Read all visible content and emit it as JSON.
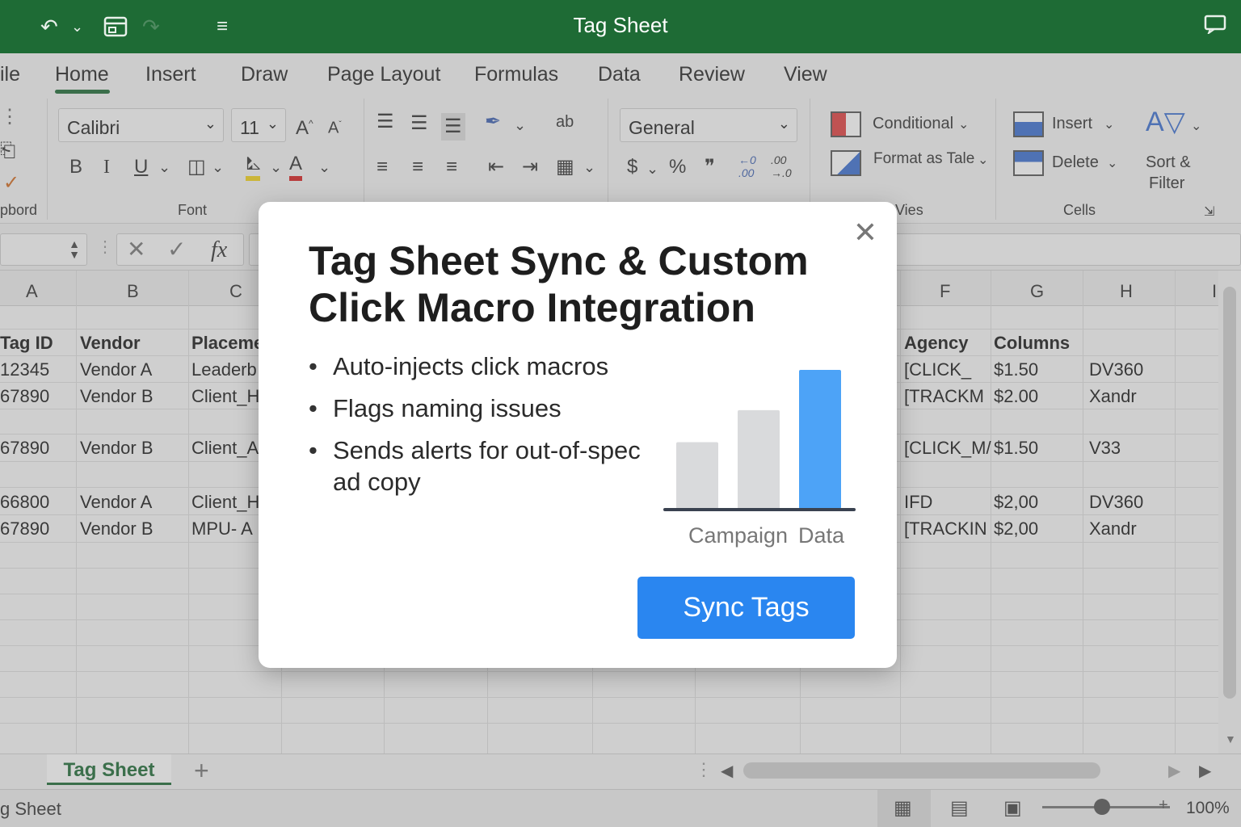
{
  "titlebar": {
    "title": "Tag Sheet"
  },
  "ribbon": {
    "tabs": [
      "ile",
      "Home",
      "Insert",
      "Draw",
      "Page Layout",
      "Formulas",
      "Data",
      "Review",
      "View"
    ],
    "active_tab": "Home",
    "font_name": "Calibri",
    "font_size": "11",
    "number_format": "General",
    "groups": {
      "clipboard": "pbord",
      "font": "Font",
      "styles": "Vies",
      "cells": "Cells"
    },
    "styles": {
      "conditional": "Conditional",
      "format_as_table": "Format as Tale"
    },
    "cells": {
      "insert": "Insert",
      "delete": "Delete"
    },
    "editing": {
      "sort_filter_line1": "Sort &",
      "sort_filter_line2": "Filter"
    }
  },
  "formula_bar": {
    "fx": "fx"
  },
  "sheet": {
    "columns": [
      "A",
      "B",
      "C",
      "F",
      "G",
      "H",
      "I"
    ],
    "rows": [
      {
        "a": "Tag ID",
        "b": "Vendor",
        "c": "Placeme",
        "f": "Agency",
        "g": "Columns",
        "h": ""
      },
      {
        "a": "12345",
        "b": "Vendor A",
        "c": "Leaderb",
        "f": "[CLICK_",
        "g": "$1.50",
        "h": "DV360"
      },
      {
        "a": "67890",
        "b": "Vendor B",
        "c": "Client_H",
        "f": "[TRACKM",
        "g": "$2.00",
        "h": "Xandr"
      },
      {
        "a": "",
        "b": "",
        "c": "",
        "f": "",
        "g": "",
        "h": ""
      },
      {
        "a": "67890",
        "b": "Vendor B",
        "c": "Client_A",
        "f": "[CLICK_M/",
        "g": "$1.50",
        "h": "V33"
      },
      {
        "a": "",
        "b": "",
        "c": "",
        "f": "",
        "g": "",
        "h": ""
      },
      {
        "a": "66800",
        "b": "Vendor A",
        "c": "Client_H",
        "f": "IFD",
        "g": "$2,00",
        "h": "DV360"
      },
      {
        "a": "67890",
        "b": "Vendor B",
        "c": "MPU- A",
        "f": "[TRACKIN",
        "g": "$2,00",
        "h": "Xandr"
      }
    ]
  },
  "sheet_tabs": {
    "active": "Tag Sheet"
  },
  "status_bar": {
    "sheet_name": "g Sheet",
    "zoom": "100%"
  },
  "modal": {
    "title": "Tag Sheet Sync & Custom Click Macro Integration",
    "bullets": [
      "Auto-injects click macros",
      "Flags naming issues",
      "Sends alerts for out-of-spec ad copy"
    ],
    "chart_labels": [
      "Campaign",
      "Data"
    ],
    "button_label": "Sync Tags",
    "colors": {
      "accent": "#2a86f0",
      "bar_highlight": "#4da3f7",
      "bar_muted": "#d9dadc"
    }
  },
  "chart_data": {
    "type": "bar",
    "categories": [
      "",
      "",
      ""
    ],
    "values": [
      48,
      71,
      100
    ],
    "xlabel": "",
    "ylabel": "",
    "tick_labels": [
      "Campaign",
      "Data"
    ],
    "ylim": [
      0,
      100
    ],
    "grid": false,
    "legend": "none"
  },
  "icons": [
    "undo-icon",
    "save-icon",
    "customize-icon",
    "comment-icon",
    "close-icon"
  ]
}
